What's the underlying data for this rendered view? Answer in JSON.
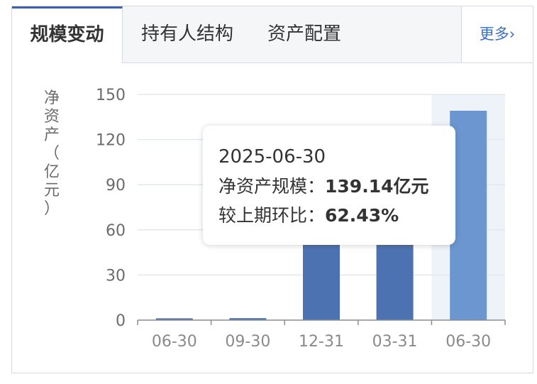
{
  "tabs": [
    {
      "label": "规模变动",
      "active": true
    },
    {
      "label": "持有人结构",
      "active": false
    },
    {
      "label": "资产配置",
      "active": false
    }
  ],
  "more_label": "更多",
  "colors": {
    "accent": "#2f64c8",
    "bar": "#4d72b1",
    "bar_highlight": "#6b96d0",
    "axis_text": "#6b6b6b",
    "grid": "#e3e7ef"
  },
  "chart_data": {
    "type": "bar",
    "ylabel": "净资产（亿元）",
    "categories": [
      "06-30",
      "09-30",
      "12-31",
      "03-31",
      "06-30"
    ],
    "series": [
      {
        "name": "净资产规模",
        "values": [
          1.2,
          1.3,
          55.0,
          85.68,
          139.14
        ]
      }
    ],
    "yticks": [
      0,
      30,
      60,
      90,
      120,
      150
    ],
    "ylim": [
      0,
      150
    ],
    "highlight_index": 4,
    "grid": true
  },
  "tooltip": {
    "date": "2025-06-30",
    "rows": [
      {
        "label": "净资产规模：",
        "value": "139.14亿元"
      },
      {
        "label": "较上期环比：",
        "value": "62.43%"
      }
    ]
  }
}
